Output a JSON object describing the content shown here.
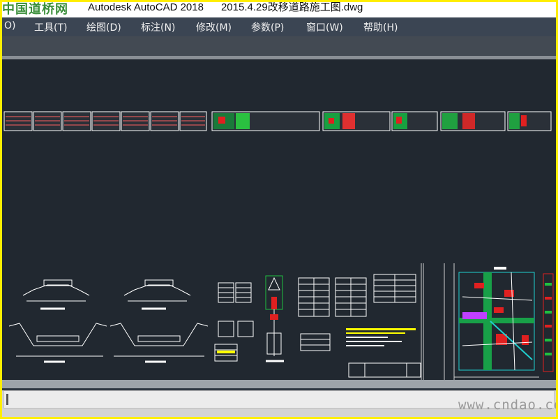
{
  "watermark_logo": "中国道桥网",
  "window": {
    "app_name": "Autodesk AutoCAD 2018",
    "file_name": "2015.4.29改移道路施工图.dwg"
  },
  "menu": {
    "items": [
      {
        "label": "O)"
      },
      {
        "label": "工具(T)"
      },
      {
        "label": "绘图(D)"
      },
      {
        "label": "标注(N)"
      },
      {
        "label": "修改(M)"
      },
      {
        "label": "参数(P)"
      },
      {
        "label": "窗口(W)"
      },
      {
        "label": "帮助(H)"
      }
    ]
  },
  "command_line": {
    "value": ""
  },
  "watermark_url": "www.cndao.com",
  "colors": {
    "canvas_bg": "#212830",
    "menubar_bg": "#3b4553",
    "drawing_lines": "#ffffff",
    "accent_red": "#e02020",
    "accent_green": "#20c040",
    "accent_cyan": "#20d0d0",
    "accent_yellow": "#ffff00",
    "accent_magenta": "#c040ff"
  }
}
